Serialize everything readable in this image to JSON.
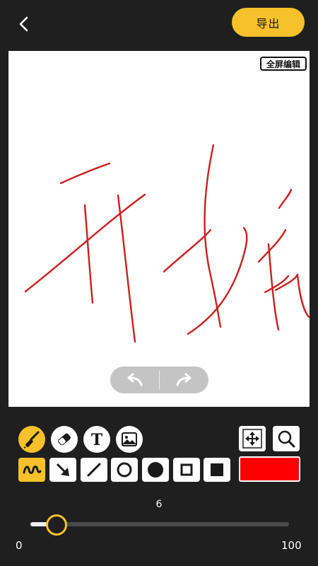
{
  "header": {
    "export_label": "导出"
  },
  "canvas": {
    "fullscreen_label": "全屏编辑",
    "stroke_color": "#cc1f1f",
    "handwritten_text": "开始"
  },
  "toolbar": {
    "row1_left": [
      "brush-icon",
      "eraser-icon",
      "text-icon",
      "image-icon"
    ],
    "row1_right": [
      "move-arrows-icon",
      "search-icon"
    ],
    "row2": [
      "freehand-icon",
      "arrow-icon",
      "line-icon",
      "circle-outline-icon",
      "circle-filled-icon",
      "square-outline-icon",
      "square-filled-icon"
    ],
    "selected_color": "#ff0000",
    "accent_color": "#f6c12a"
  },
  "size_slider": {
    "value": "6",
    "min": "0",
    "max": "100",
    "value_fraction": 0.06
  }
}
